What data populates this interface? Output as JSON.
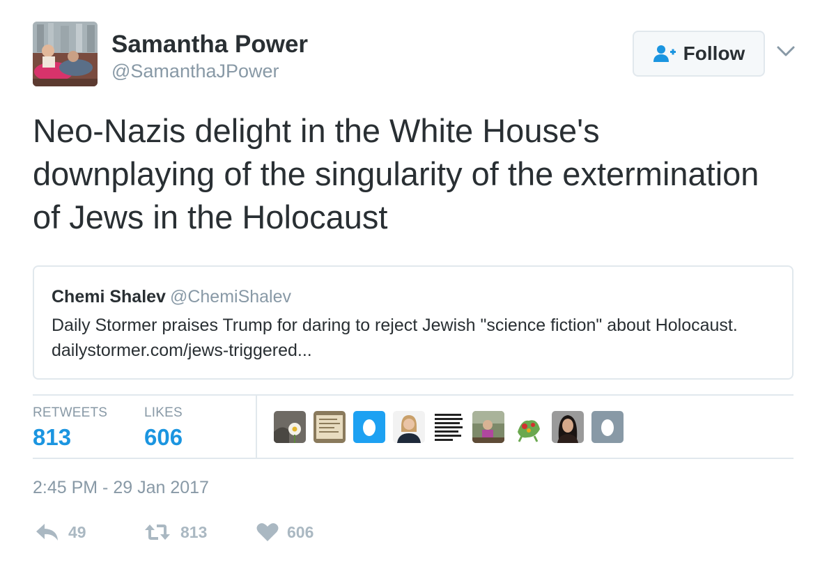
{
  "author": {
    "name": "Samantha Power",
    "handle": "@SamanthaJPower"
  },
  "follow_button": {
    "label": "Follow",
    "icon": "follow-user-plus-icon"
  },
  "more_menu": {
    "icon": "chevron-down-icon"
  },
  "tweet": {
    "text": "Neo-Nazis delight in the White House's downplaying of the singularity of the extermination of Jews in the Holocaust"
  },
  "quoted_tweet": {
    "name": "Chemi Shalev",
    "handle": "@ChemiShalev",
    "text": "Daily Stormer praises Trump for daring to reject Jewish \"science fiction\" about Holocaust.  dailystormer.com/jews-triggered..."
  },
  "stats": {
    "retweets_label": "RETWEETS",
    "retweets_count": "813",
    "likes_label": "LIKES",
    "likes_count": "606"
  },
  "likers": [
    {
      "icon": "liker-avatar-flower"
    },
    {
      "icon": "liker-avatar-note"
    },
    {
      "icon": "liker-avatar-egg-blue"
    },
    {
      "icon": "liker-avatar-woman"
    },
    {
      "icon": "liker-avatar-text"
    },
    {
      "icon": "liker-avatar-outdoor"
    },
    {
      "icon": "liker-avatar-cartoon"
    },
    {
      "icon": "liker-avatar-woman-dark"
    },
    {
      "icon": "liker-avatar-egg-gray"
    }
  ],
  "timestamp": "2:45 PM - 29 Jan 2017",
  "actions": {
    "reply_count": "49",
    "retweet_count": "813",
    "like_count": "606"
  },
  "colors": {
    "link_blue": "#1b95e0",
    "text_dark": "#292f33",
    "text_gray": "#8899a6",
    "border": "#e1e8ed",
    "action_gray": "#aab8c2",
    "follow_icon_blue": "#1b95e0"
  }
}
